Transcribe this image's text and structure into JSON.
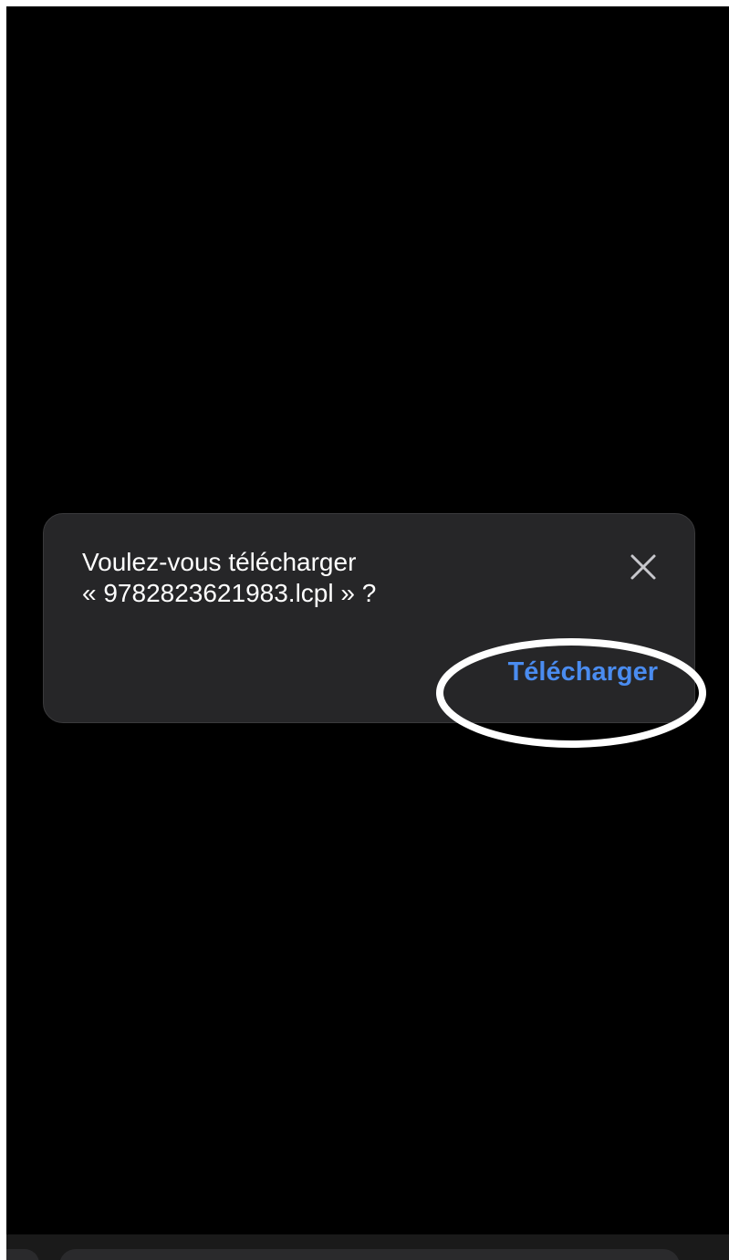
{
  "dialog": {
    "message_line1": "Voulez-vous télécharger",
    "message_line2": "« 9782823621983.lcpl » ?",
    "close_icon": "close-icon",
    "download_label": "Télécharger"
  },
  "colors": {
    "background": "#000000",
    "dialog_bg": "#262628",
    "text": "#ffffff",
    "accent": "#4a8cf0",
    "annotation_ring": "#ffffff"
  }
}
